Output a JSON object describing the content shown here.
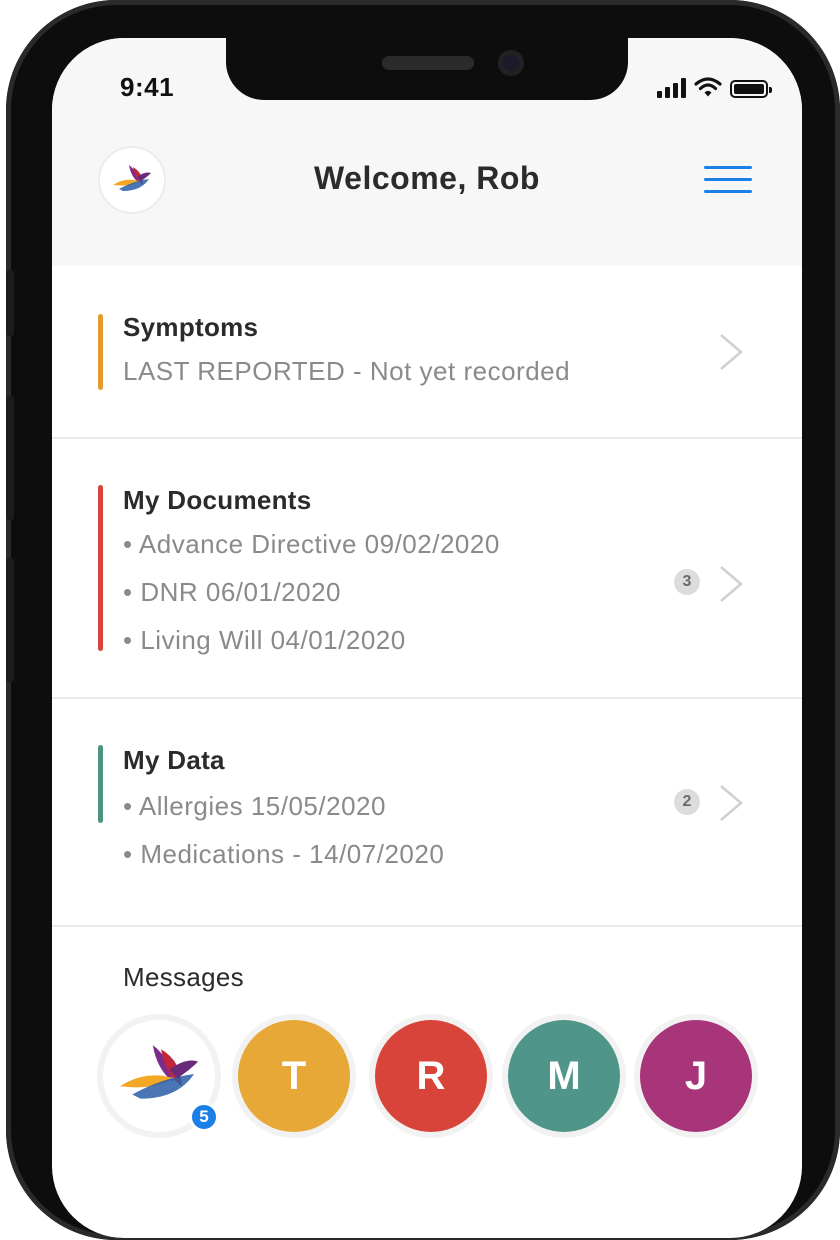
{
  "status_bar": {
    "time": "9:41"
  },
  "header": {
    "title": "Welcome, Rob"
  },
  "colors": {
    "symptoms_accent": "#e39a2f",
    "documents_accent": "#d9443a",
    "data_accent": "#4f9482",
    "menu_accent": "#1a7fe6"
  },
  "symptoms": {
    "title": "Symptoms",
    "subtitle": "LAST REPORTED - Not yet recorded"
  },
  "documents": {
    "title": "My Documents",
    "items": [
      "• Advance Directive  09/02/2020",
      "• DNR 06/01/2020",
      "• Living Will 04/01/2020"
    ],
    "count": "3"
  },
  "my_data": {
    "title": "My Data",
    "items": [
      "• Allergies  15/05/2020",
      "• Medications - 14/07/2020"
    ],
    "count": "2"
  },
  "messages": {
    "title": "Messages",
    "app_unread": "5",
    "contacts": [
      {
        "initial": "T",
        "color": "#e8a838"
      },
      {
        "initial": "R",
        "color": "#d9443a"
      },
      {
        "initial": "M",
        "color": "#50958a"
      },
      {
        "initial": "J",
        "color": "#a83579"
      }
    ]
  }
}
